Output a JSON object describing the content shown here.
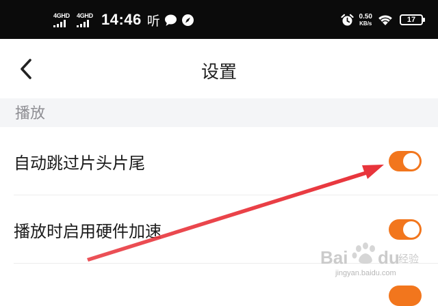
{
  "status_bar": {
    "network_1": "4GHD",
    "network_2": "4GHD",
    "time": "14:46",
    "listen_glyph": "听",
    "speed_value": "0.50",
    "speed_unit": "KB/s",
    "battery": "17",
    "icons": [
      "signal-icon",
      "message-icon",
      "compass-icon",
      "alarm-icon",
      "wifi-icon",
      "battery-icon"
    ]
  },
  "header": {
    "title": "设置",
    "back_icon": "chevron-left-icon"
  },
  "section": {
    "label": "播放"
  },
  "settings": [
    {
      "label": "自动跳过片头片尾",
      "enabled": true
    },
    {
      "label": "播放时启用硬件加速",
      "enabled": true
    }
  ],
  "annotation": {
    "arrow_color": "#e8333a"
  },
  "watermark": {
    "brand": "Baidu经验",
    "url": "jingyan.baidu.com"
  },
  "colors": {
    "accent": "#f2761d",
    "status_bar": "#0b0b0b",
    "section_bg": "#f4f5f7"
  }
}
